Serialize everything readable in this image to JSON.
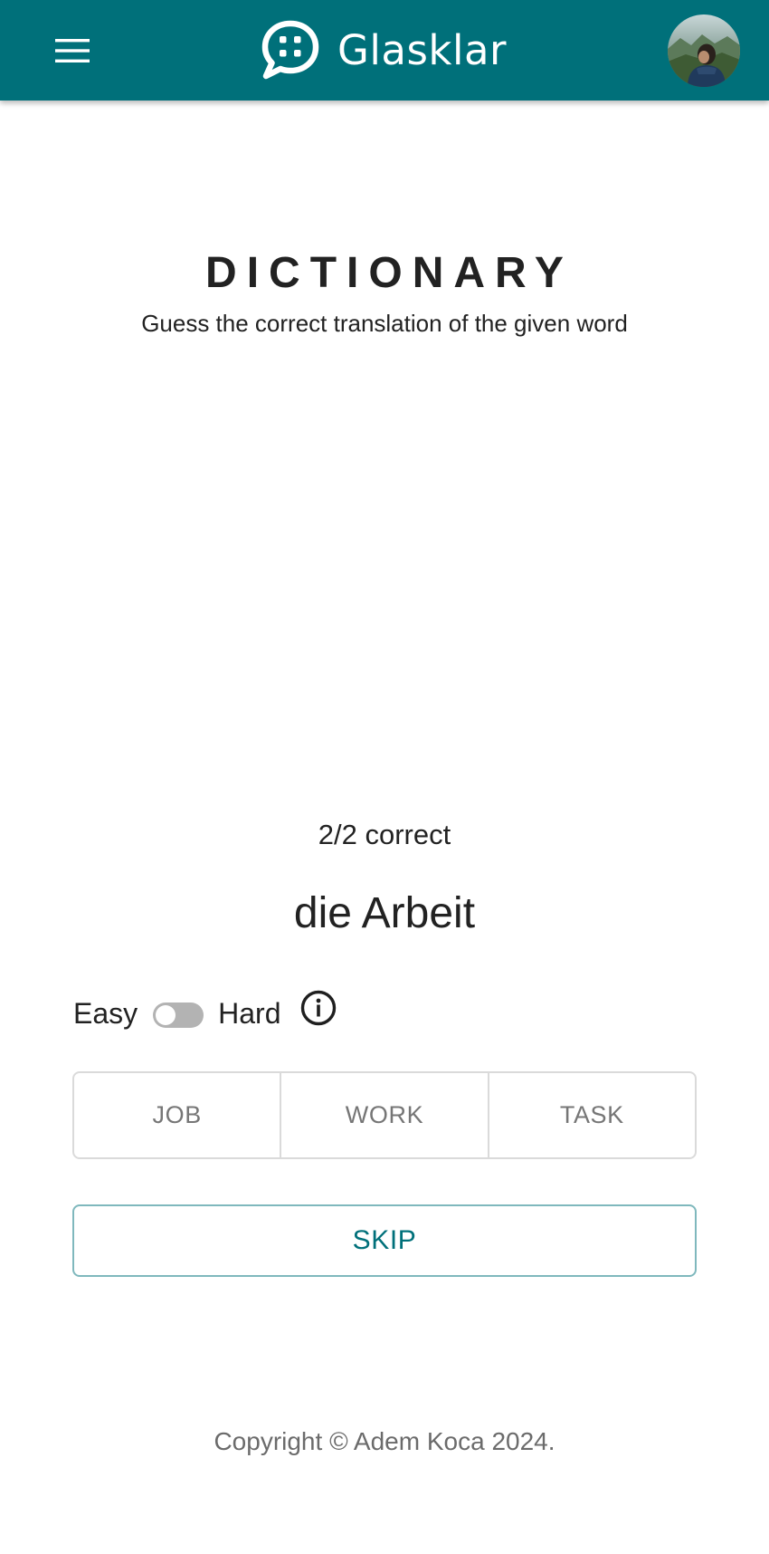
{
  "app": {
    "name": "Glasklar"
  },
  "header": {
    "menu_icon": "hamburger-menu-icon",
    "logo_icon": "chat-bubble-icon",
    "avatar": "user-avatar-photo"
  },
  "page": {
    "title": "DICTIONARY",
    "subtitle": "Guess the correct translation of the given word"
  },
  "quiz": {
    "score": "2/2 correct",
    "word": "die Arbeit",
    "difficulty": {
      "easy_label": "Easy",
      "hard_label": "Hard",
      "hard_mode_on": false,
      "info_icon": "info-circle-icon"
    },
    "options": [
      "JOB",
      "WORK",
      "TASK"
    ],
    "skip_label": "SKIP"
  },
  "footer": {
    "copyright": "Copyright © Adem Koca 2024."
  },
  "colors": {
    "primary": "#00707a",
    "skip_border": "#7fb8bd",
    "option_border": "#dadada",
    "switch_track": "#b3b3b3"
  }
}
